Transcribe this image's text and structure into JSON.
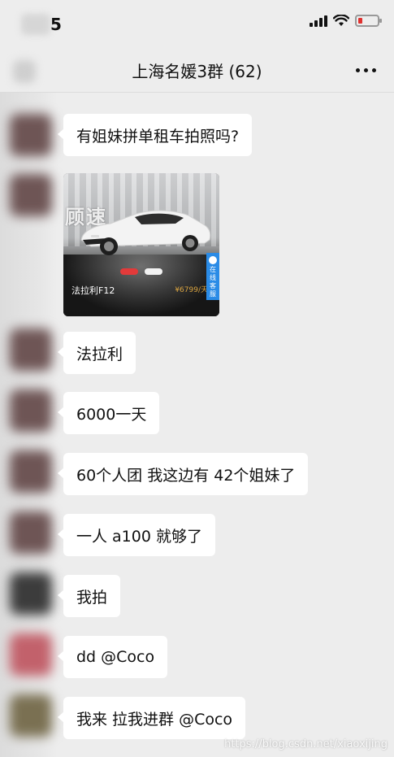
{
  "status_bar": {
    "time": "5"
  },
  "nav": {
    "title": "上海名媛3群 (62)"
  },
  "messages": [
    {
      "text": "有姐妹拼单租车拍照吗?"
    },
    {
      "text": "法拉利"
    },
    {
      "text": "6000一天"
    },
    {
      "text": "60个人团 我这边有 42个姐妹了"
    },
    {
      "text": "一人 a100 就够了"
    },
    {
      "text": "我拍"
    },
    {
      "text": "dd @Coco"
    },
    {
      "text": "我来 拉我进群 @Coco"
    }
  ],
  "image_card": {
    "overlay_text": "顾速",
    "car_name": "法拉利F12",
    "price": "¥6799/天",
    "service_label": "在线客服"
  },
  "watermark": "https://blog.csdn.net/xiaoxijing",
  "colors": {
    "background": "#ededed",
    "bubble": "#ffffff",
    "battery_low": "#e0302e",
    "service_blue": "#2a8be6"
  }
}
